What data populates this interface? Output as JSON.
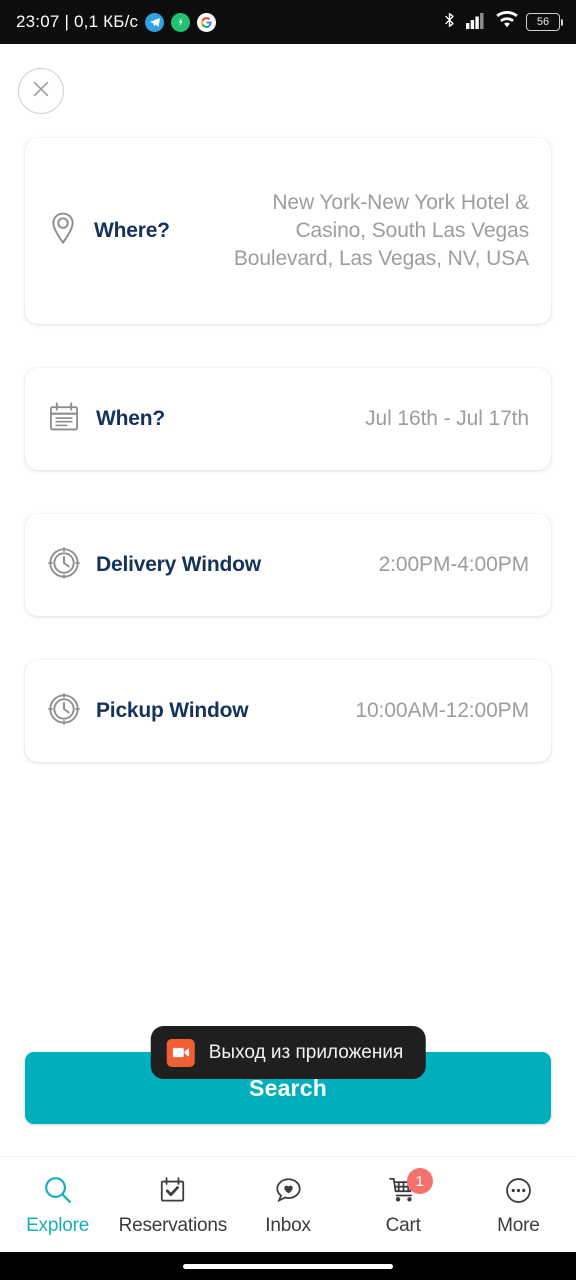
{
  "statusbar": {
    "clock": "23:07 | 0,1 КБ/c",
    "app_icons": [
      {
        "name": "telegram-icon",
        "color": "#2fa3e3"
      },
      {
        "name": "shield-security-icon",
        "color": "#22c272"
      },
      {
        "name": "google-icon",
        "color": "#ffffff"
      }
    ],
    "bluetooth_icon": "bluetooth-icon",
    "signal_icon": "cellular-signal-icon",
    "wifi_icon": "wifi-icon",
    "battery_level": "56"
  },
  "header": {
    "close_icon": "close-icon"
  },
  "cards": [
    {
      "icon": "location-pin-icon",
      "label": "Where?",
      "value": "New York-New York Hotel & Casino, South Las Vegas Boulevard, Las Vegas, NV, USA",
      "size": "tall"
    },
    {
      "icon": "calendar-icon",
      "label": "When?",
      "value": "Jul 16th - Jul 17th",
      "size": "short"
    },
    {
      "icon": "clock-icon",
      "label": "Delivery Window",
      "value": "2:00PM-4:00PM",
      "size": "short"
    },
    {
      "icon": "clock-icon",
      "label": "Pickup Window",
      "value": "10:00AM-12:00PM",
      "size": "short"
    }
  ],
  "toast": {
    "icon": "video-camera-icon",
    "text": "Выход из приложения"
  },
  "search": {
    "label": "Search"
  },
  "bottomnav": [
    {
      "icon": "search-icon",
      "label": "Explore",
      "active": true,
      "badge": null
    },
    {
      "icon": "calendar-check-icon",
      "label": "Reservations",
      "active": false,
      "badge": null
    },
    {
      "icon": "chat-heart-icon",
      "label": "Inbox",
      "active": false,
      "badge": null
    },
    {
      "icon": "shopping-cart-icon",
      "label": "Cart",
      "active": false,
      "badge": "1"
    },
    {
      "icon": "more-dots-icon",
      "label": "More",
      "active": false,
      "badge": null
    }
  ],
  "colors": {
    "accent_teal": "#00afbd",
    "label_navy": "#15325c",
    "value_gray": "#9d9d9d",
    "badge_red": "#f3736c",
    "toast_bg": "#1f1f1f",
    "toast_icon_orange": "#ef5f33"
  }
}
